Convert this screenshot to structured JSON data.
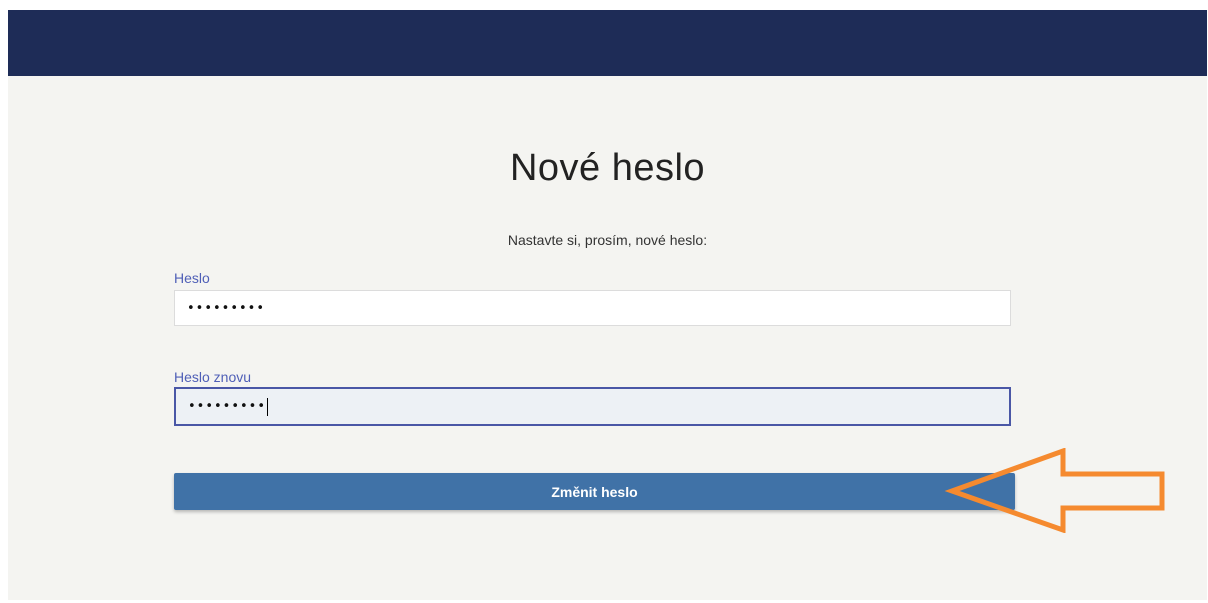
{
  "page": {
    "title": "Nové heslo",
    "subtitle": "Nastavte si, prosím, nové heslo:"
  },
  "form": {
    "password_label": "Heslo",
    "password_value": "•••••••••",
    "password_repeat_label": "Heslo znovu",
    "password_repeat_value": "•••••••••",
    "submit_label": "Změnit heslo"
  },
  "colors": {
    "header": "#1e2c57",
    "background": "#f4f4f1",
    "label": "#4f5fb7",
    "focus_border": "#4a57a6",
    "button": "#4072a7",
    "annotation_arrow": "#f58a2f"
  },
  "icons": {
    "annotation": "orange-arrow-left-icon"
  }
}
